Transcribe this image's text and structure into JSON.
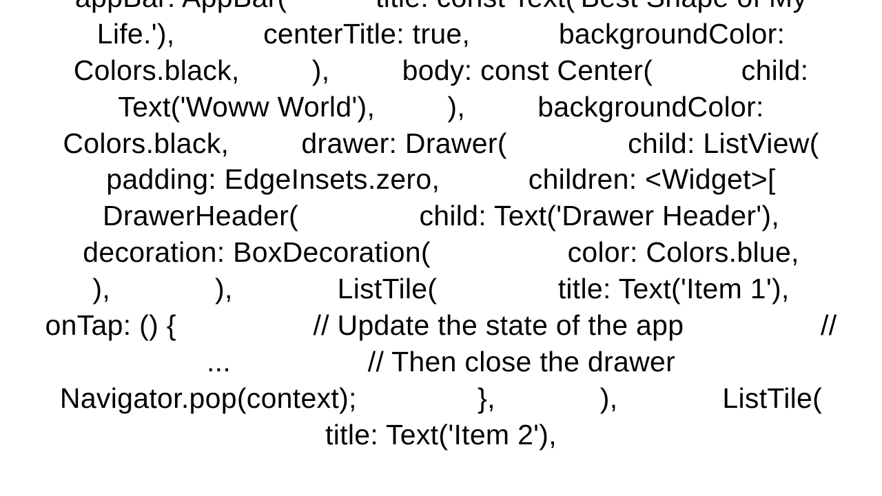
{
  "code_text": "appBar: AppBar(           title: const Text('Best Shape of My Life.'),           centerTitle: true,           backgroundColor: Colors.black,         ),         body: const Center(           child: Text('Woww World'),         ),         backgroundColor: Colors.black,         drawer: Drawer(               child: ListView(           padding: EdgeInsets.zero,           children: <Widget>[             DrawerHeader(               child: Text('Drawer Header'),               decoration: BoxDecoration(                 color: Colors.blue,               ),             ),             ListTile(               title: Text('Item 1'),               onTap: () {                 // Update the state of the app                 // ...                 // Then close the drawer                 Navigator.pop(context);               },             ),             ListTile(               title: Text('Item 2'),"
}
